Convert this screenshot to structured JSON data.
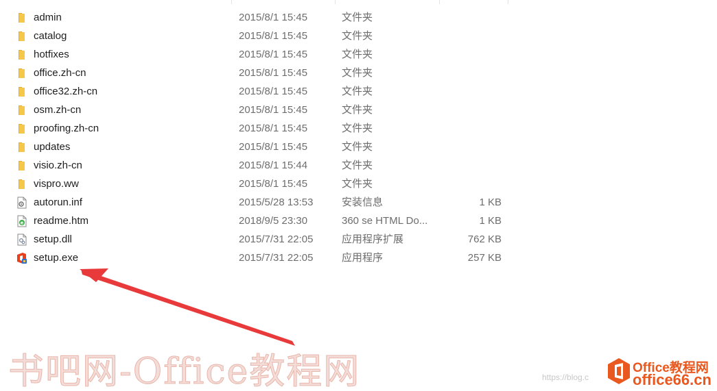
{
  "files": [
    {
      "name": "admin",
      "date": "2015/8/1 15:45",
      "type": "文件夹",
      "size": "",
      "icon": "folder-icon"
    },
    {
      "name": "catalog",
      "date": "2015/8/1 15:45",
      "type": "文件夹",
      "size": "",
      "icon": "folder-icon"
    },
    {
      "name": "hotfixes",
      "date": "2015/8/1 15:45",
      "type": "文件夹",
      "size": "",
      "icon": "folder-icon"
    },
    {
      "name": "office.zh-cn",
      "date": "2015/8/1 15:45",
      "type": "文件夹",
      "size": "",
      "icon": "folder-icon"
    },
    {
      "name": "office32.zh-cn",
      "date": "2015/8/1 15:45",
      "type": "文件夹",
      "size": "",
      "icon": "folder-icon"
    },
    {
      "name": "osm.zh-cn",
      "date": "2015/8/1 15:45",
      "type": "文件夹",
      "size": "",
      "icon": "folder-icon"
    },
    {
      "name": "proofing.zh-cn",
      "date": "2015/8/1 15:45",
      "type": "文件夹",
      "size": "",
      "icon": "folder-icon"
    },
    {
      "name": "updates",
      "date": "2015/8/1 15:45",
      "type": "文件夹",
      "size": "",
      "icon": "folder-icon"
    },
    {
      "name": "visio.zh-cn",
      "date": "2015/8/1 15:44",
      "type": "文件夹",
      "size": "",
      "icon": "folder-icon"
    },
    {
      "name": "vispro.ww",
      "date": "2015/8/1 15:45",
      "type": "文件夹",
      "size": "",
      "icon": "folder-icon"
    },
    {
      "name": "autorun.inf",
      "date": "2015/5/28 13:53",
      "type": "安装信息",
      "size": "1 KB",
      "icon": "setup-info-file-icon"
    },
    {
      "name": "readme.htm",
      "date": "2018/9/5 23:30",
      "type": "360 se HTML Do...",
      "size": "1 KB",
      "icon": "html-file-icon"
    },
    {
      "name": "setup.dll",
      "date": "2015/7/31 22:05",
      "type": "应用程序扩展",
      "size": "762 KB",
      "icon": "dll-file-icon"
    },
    {
      "name": "setup.exe",
      "date": "2015/7/31 22:05",
      "type": "应用程序",
      "size": "257 KB",
      "icon": "office-setup-exe-icon"
    }
  ],
  "watermark": {
    "text": "书吧网-Office教程网"
  },
  "blog_url": "https://blog.c",
  "brand": {
    "top": "Office教程网",
    "bottom": "office66.cn"
  },
  "colors": {
    "folder": "#f5c84c",
    "arrow": "#e83a3a",
    "brand": "#e8581f"
  }
}
